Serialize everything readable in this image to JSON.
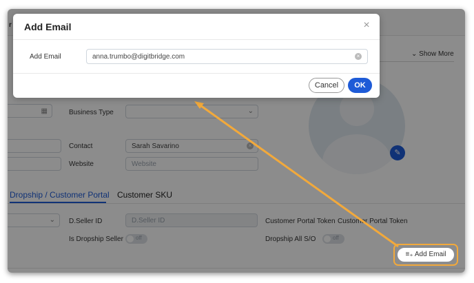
{
  "background": {
    "header_fragment": "r",
    "show_more": "Show More",
    "labels": {
      "business_type": "Business Type",
      "contact": "Contact",
      "website": "Website",
      "d_seller_id": "D.Seller ID",
      "is_dropship_seller": "Is Dropship Seller",
      "customer_portal_token": "Customer Portal Token",
      "dropship_all_so": "Dropship All S/O"
    },
    "values": {
      "contact": "Sarah Savarino"
    },
    "placeholders": {
      "website": "Website",
      "d_seller_id": "D.Seller ID",
      "customer_portal_token": "Customer Portal Token"
    },
    "toggle_text": "off",
    "tabs": [
      {
        "label": "Dropship / Customer Portal",
        "active": true
      },
      {
        "label": "Customer SKU",
        "active": false
      }
    ],
    "add_email_button": "Add Email"
  },
  "modal": {
    "title": "Add Email",
    "field_label": "Add Email",
    "field_value": "anna.trumbo@digitbridge.com",
    "cancel_label": "Cancel",
    "ok_label": "OK"
  },
  "colors": {
    "accent": "#1e5bd7",
    "annotation": "#f2a93b"
  }
}
